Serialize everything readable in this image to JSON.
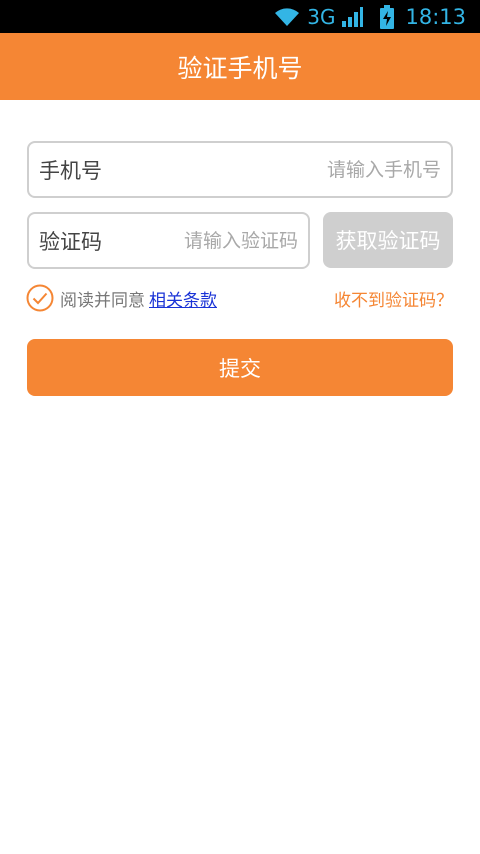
{
  "status_bar": {
    "network": "3G",
    "time": "18:13",
    "wifi_icon": "wifi-icon",
    "signal_icon": "signal-icon",
    "battery_icon": "battery-charging-icon",
    "accent": "#33b5e5"
  },
  "header": {
    "title": "验证手机号",
    "color": "#f58634"
  },
  "form": {
    "phone": {
      "label": "手机号",
      "placeholder": "请输入手机号",
      "value": ""
    },
    "code": {
      "label": "验证码",
      "placeholder": "请输入验证码",
      "value": ""
    },
    "get_code_label": "获取验证码",
    "agree_text": "阅读并同意",
    "terms_label": "相关条款",
    "no_code_label": "收不到验证码？",
    "agree_checked": true,
    "submit_label": "提交"
  },
  "colors": {
    "brand": "#f58634",
    "link": "#1a33d6",
    "disabled_button": "#cfcfcf"
  }
}
